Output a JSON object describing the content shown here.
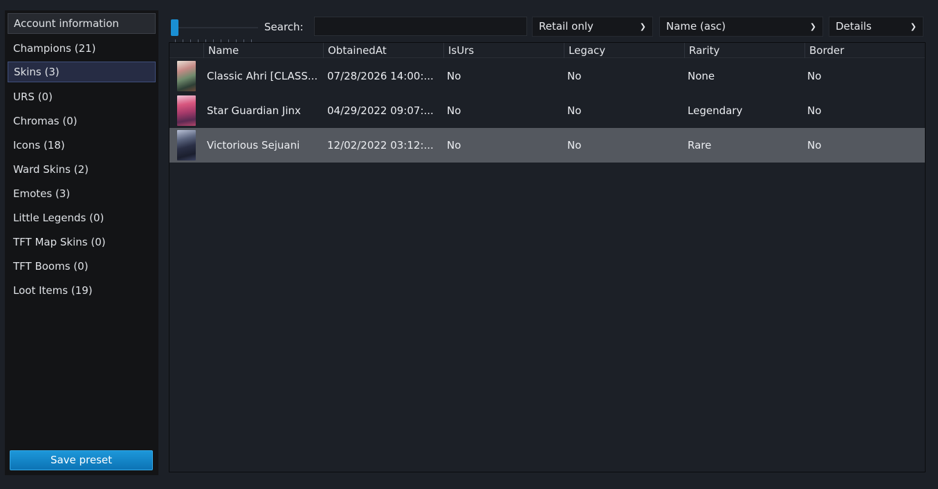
{
  "sidebar": {
    "items": [
      {
        "label": "Account information"
      },
      {
        "label": "Champions (21)"
      },
      {
        "label": "Skins (3)"
      },
      {
        "label": "URS (0)"
      },
      {
        "label": "Chromas (0)"
      },
      {
        "label": "Icons (18)"
      },
      {
        "label": "Ward Skins (2)"
      },
      {
        "label": "Emotes (3)"
      },
      {
        "label": "Little Legends (0)"
      },
      {
        "label": "TFT Map Skins (0)"
      },
      {
        "label": "TFT Booms (0)"
      },
      {
        "label": "Loot Items (19)"
      }
    ],
    "selected": "Skins (3)",
    "save_label": "Save preset"
  },
  "toolbar": {
    "search_label": "Search:",
    "search_value": "",
    "zoom_level": 0,
    "filter_selected": "Retail only",
    "sort_selected": "Name (asc)",
    "view_selected": "Details"
  },
  "table": {
    "columns": [
      "Name",
      "ObtainedAt",
      "IsUrs",
      "Legacy",
      "Rarity",
      "Border"
    ],
    "rows": [
      {
        "name": "Classic Ahri [CLASS...",
        "obtained": "07/28/2026 14:00:...",
        "isurs": "No",
        "legacy": "No",
        "rarity": "None",
        "border": "No",
        "thumb_icon": "ahri-splash-thumbnail"
      },
      {
        "name": "Star Guardian Jinx",
        "obtained": "04/29/2022 09:07:...",
        "isurs": "No",
        "legacy": "No",
        "rarity": "Legendary",
        "border": "No",
        "thumb_icon": "jinx-splash-thumbnail"
      },
      {
        "name": "Victorious Sejuani",
        "obtained": "12/02/2022 03:12:...",
        "isurs": "No",
        "legacy": "No",
        "rarity": "Rare",
        "border": "No",
        "thumb_icon": "sejuani-splash-thumbnail"
      }
    ],
    "selected_row": 2
  },
  "colors": {
    "background": "#1c2027",
    "sidebar": "#131416",
    "accent": "#1a8fd3",
    "selected_row": "#54585f",
    "selected_side": "#262c44"
  }
}
